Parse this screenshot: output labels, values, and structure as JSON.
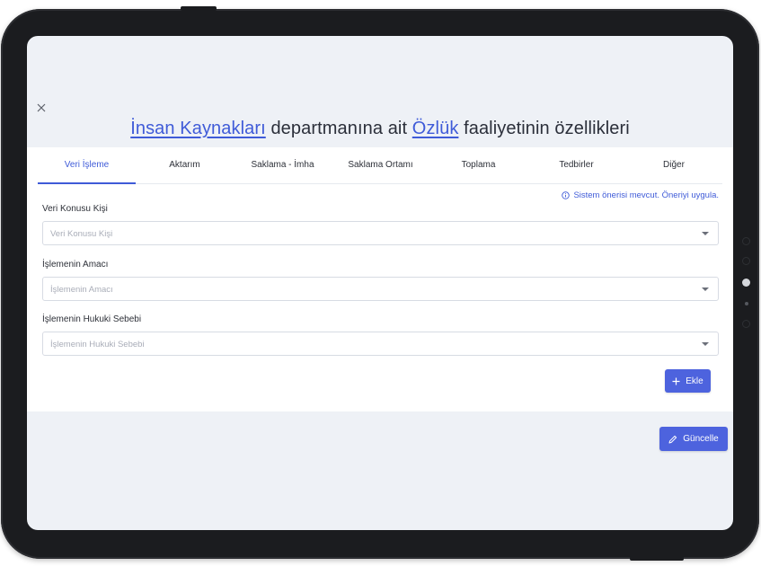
{
  "header": {
    "title_link1": "İnsan Kaynakları",
    "title_text1": " departmanına ait ",
    "title_link2": "Özlük",
    "title_text2": " faaliyetinin özellikleri"
  },
  "tabs": [
    {
      "label": "Veri İşleme",
      "active": true
    },
    {
      "label": "Aktarım"
    },
    {
      "label": "Saklama - İmha"
    },
    {
      "label": "Saklama Ortamı"
    },
    {
      "label": "Toplama"
    },
    {
      "label": "Tedbirler"
    },
    {
      "label": "Diğer"
    }
  ],
  "hint": "Sistem önerisi mevcut. Öneriyi uygula.",
  "fields": [
    {
      "label": "Veri Konusu Kişi",
      "placeholder": "Veri Konusu Kişi"
    },
    {
      "label": "İşlemenin Amacı",
      "placeholder": "İşlemenin Amacı"
    },
    {
      "label": "İşlemenin Hukuki Sebebi",
      "placeholder": "İşlemenin Hukuki Sebebi"
    }
  ],
  "buttons": {
    "add": "Ekle",
    "update": "Güncelle"
  },
  "colors": {
    "accent": "#3f5bd8",
    "button": "#4d63de",
    "background": "#eef1f6"
  },
  "icons": {
    "close": "close-icon",
    "info": "info-icon",
    "plus": "plus-icon",
    "pencil": "pencil-icon",
    "caret": "chevron-down-icon"
  }
}
